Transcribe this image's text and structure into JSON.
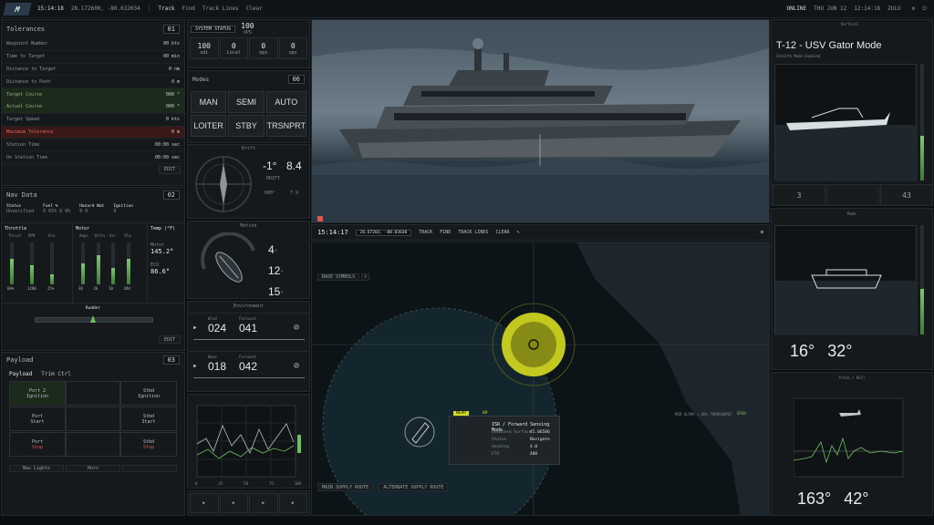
{
  "topbar": {
    "logo": "M",
    "time": "15:14:18",
    "coords": "28.172600, -80.632034",
    "track": "Track",
    "find": "Find",
    "track_lines": "Track Lines",
    "clear": "Clear",
    "status_left": "ONLINE",
    "date": "THU JUN 12",
    "clock": "12:14:18",
    "zone": "ZULU"
  },
  "left": {
    "tolerances": {
      "title": "Tolerances",
      "count": "01",
      "rows": [
        {
          "label": "Waypoint Number",
          "value": "00",
          "unit": "kts"
        },
        {
          "label": "Time to Target",
          "value": "00",
          "unit": "min"
        },
        {
          "label": "Distance to Target",
          "value": "0",
          "unit": "nm"
        },
        {
          "label": "Distance to Path",
          "value": "0",
          "unit": "m"
        },
        {
          "label": "Target Course",
          "value": "000",
          "unit": "°"
        },
        {
          "label": "Actual Course",
          "value": "000",
          "unit": "°"
        },
        {
          "label": "Target Speed",
          "value": "0",
          "unit": "kts"
        },
        {
          "label": "Maximum Tolerance",
          "value": "0",
          "unit": "m"
        },
        {
          "label": "Station Time",
          "value": "00:00",
          "unit": "sec"
        },
        {
          "label": "On Station Time",
          "value": "00:00",
          "unit": "sec"
        }
      ],
      "footer": "EDIT"
    },
    "nav": {
      "title": "Nav Data",
      "count": "02",
      "gps": "Status",
      "gps_val": "Unverified",
      "fuel": "Fuel %",
      "fuel_val": "0  65%  0  0%",
      "haz": "Hazard Wat",
      "haz_val": "0  0",
      "ign": "Ignition",
      "ign_val": "0",
      "throttle": "Throttle",
      "thr_cols": [
        "Thrust",
        "RPM",
        "Eco"
      ],
      "thr_vals": [
        "60%",
        "1200",
        "25%"
      ],
      "motor": "Motor",
      "motor_cols": [
        "Amps",
        "Volts",
        "Usr",
        "Dly"
      ],
      "motor_vals": [
        "38",
        "26",
        "10",
        "28V"
      ],
      "temp": "Temp (°F)",
      "temp1_label": "Motor",
      "temp1": "145.2°",
      "temp2_label": "ECU",
      "temp2": "86.6°",
      "rudder": "Rudder",
      "footer": "EDIT"
    },
    "payload": {
      "title": "Payload",
      "count": "03",
      "tab1": "Payload",
      "tab2": "Trim Ctrl",
      "cells": [
        [
          "Port 2",
          "Ignition"
        ],
        [
          "Stbd",
          "Ignition"
        ],
        [
          "Port",
          "Start"
        ],
        [
          "Stbd",
          "Start"
        ],
        [
          "Port",
          "Stop"
        ],
        [
          "Stbd",
          "Stop"
        ]
      ],
      "nav_lights": "Nav Lights",
      "horn": "Horn"
    }
  },
  "mid": {
    "sys_title": "SYSTEM STATUS",
    "sys_val": "100",
    "sys_sub": "OPS",
    "mode_vals": [
      {
        "v": "100",
        "s": "sdi"
      },
      {
        "v": "0",
        "s": "Local"
      },
      {
        "v": "0",
        "s": "ops"
      },
      {
        "v": "0",
        "s": "ops"
      }
    ],
    "modes_title": "Modes",
    "modes_count": "06",
    "modes": [
      "MAN",
      "SEMI",
      "AUTO",
      "LOITER",
      "STBY",
      "TRSNPRT"
    ],
    "drift": "Drift",
    "drift_val": "-1°",
    "drift_val2": "8.4",
    "drift_sub": "DRIFT",
    "drift_rows": [
      "000°",
      "7.9"
    ],
    "motion": "Motion",
    "motion_vals": [
      {
        "v": "4",
        "u": "°"
      },
      {
        "v": "12",
        "u": "°"
      },
      {
        "v": "15",
        "u": "°"
      }
    ],
    "env": "Environment",
    "env_rows": [
      {
        "a": "024",
        "b": "041",
        "al": "Wind",
        "bl": "Forecast"
      },
      {
        "a": "018",
        "b": "042",
        "al": "Wave",
        "bl": "Forecast"
      }
    ],
    "graph_axis": [
      "0",
      "25",
      "50",
      "75",
      "100"
    ]
  },
  "camera": {
    "time": "15:14:17",
    "pos": "26.67203, -80.03030",
    "track": "TRACK",
    "find": "FIND",
    "track_lines": "TRACK LINES",
    "clear": "CLEAR"
  },
  "map": {
    "base": "BASE SYMBOLS",
    "popup_tag": "NEAR",
    "popup_id": "09",
    "popup_title": "ISR / Forward Sensing Mode",
    "popup_lines": [
      "Unmanned Surface",
      "Status",
      "Heading",
      "ETA"
    ],
    "popup_vals": [
      "45.06586",
      "Navigate",
      "4.0",
      "400"
    ],
    "btn1": "MAIN SUPPLY ROUTE",
    "btn2": "ALTERNATE SUPPLY ROUTE",
    "right_label": "MSR ALPHA = 60% THROUGHPUT",
    "right_tag": "OPEN"
  },
  "right": {
    "title": "T-12 - USV Gator Mode",
    "sub": "Stealth Mode Enabled",
    "view1": "Vertical",
    "stat1": "3",
    "stat2": "43",
    "view2": "Mode",
    "heading": "16°",
    "heading2": "32°",
    "view3": "Pitch / Roll",
    "pitch": "163°",
    "roll": "42°"
  },
  "colors": {
    "accent": "#d6dc1e",
    "green": "#6fbf62",
    "red": "#d9594c"
  }
}
